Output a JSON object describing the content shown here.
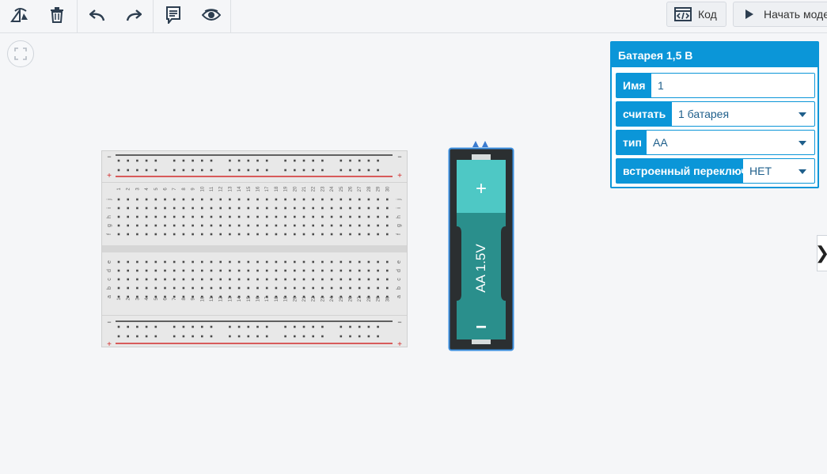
{
  "toolbar": {
    "tools": [
      {
        "name": "rotate-icon"
      },
      {
        "name": "trash-icon"
      },
      {
        "name": "undo-icon"
      },
      {
        "name": "redo-icon"
      },
      {
        "name": "notes-icon"
      },
      {
        "name": "eye-icon"
      }
    ],
    "code_label": "Код",
    "start_label": "Начать моде"
  },
  "breadboard": {
    "columns": 30,
    "row_letters_top": [
      "j",
      "i",
      "h",
      "g",
      "f"
    ],
    "row_letters_bottom": [
      "e",
      "d",
      "c",
      "b",
      "a"
    ],
    "rail_minus": "−",
    "rail_plus": "+"
  },
  "battery": {
    "label": "AA 1.5V",
    "plus": "+",
    "minus": "−",
    "color": "#2a8f8c"
  },
  "inspector": {
    "title": "Батарея 1,5 В",
    "fields": [
      {
        "label": "Имя",
        "value": "1",
        "type": "input"
      },
      {
        "label": "считать",
        "value": "1 батарея",
        "type": "select"
      },
      {
        "label": "тип",
        "value": "AA",
        "type": "select"
      },
      {
        "label": "встроенный переключатель",
        "value": "НЕТ",
        "type": "select"
      }
    ]
  },
  "side_toggle": "❯",
  "colors": {
    "accent": "#0b96d8",
    "rail_red": "#d22c2c",
    "rail_black": "#333333"
  }
}
